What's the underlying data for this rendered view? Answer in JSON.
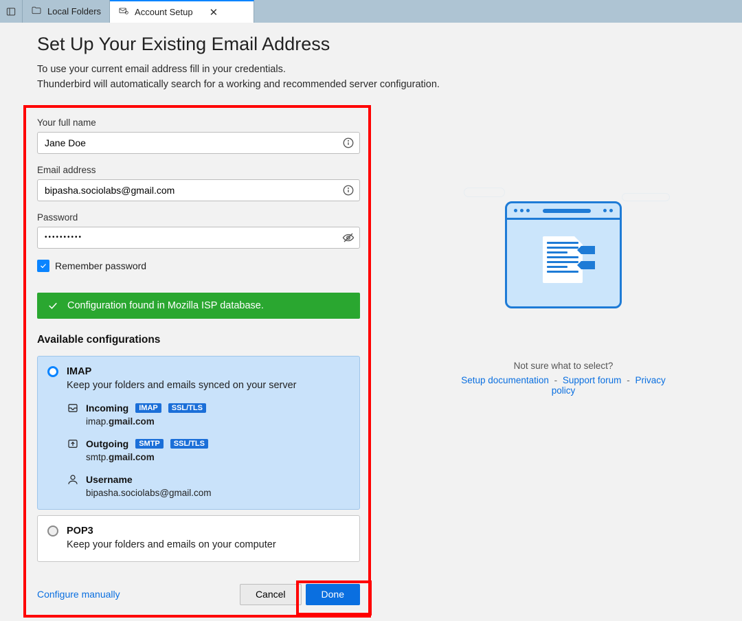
{
  "tabs": {
    "first": "Local Folders",
    "second": "Account Setup"
  },
  "heading": "Set Up Your Existing Email Address",
  "subtitle_l1": "To use your current email address fill in your credentials.",
  "subtitle_l2": "Thunderbird will automatically search for a working and recommended server configuration.",
  "fields": {
    "fullname_label": "Your full name",
    "fullname_value": "Jane Doe",
    "email_label": "Email address",
    "email_value": "bipasha.sociolabs@gmail.com",
    "password_label": "Password",
    "password_value": "••••••••••",
    "remember_label": "Remember password"
  },
  "alert_text": "Configuration found in Mozilla ISP database.",
  "available_title": "Available configurations",
  "imap": {
    "title": "IMAP",
    "desc": "Keep your folders and emails synced on your server",
    "incoming_label": "Incoming",
    "incoming_badge1": "IMAP",
    "incoming_badge2": "SSL/TLS",
    "incoming_host_pre": "imap.",
    "incoming_host_bold": "gmail.com",
    "outgoing_label": "Outgoing",
    "outgoing_badge1": "SMTP",
    "outgoing_badge2": "SSL/TLS",
    "outgoing_host_pre": "smtp.",
    "outgoing_host_bold": "gmail.com",
    "username_label": "Username",
    "username_value": "bipasha.sociolabs@gmail.com"
  },
  "pop3": {
    "title": "POP3",
    "desc": "Keep your folders and emails on your computer"
  },
  "actions": {
    "manual": "Configure manually",
    "cancel": "Cancel",
    "done": "Done"
  },
  "help": {
    "prompt": "Not sure what to select?",
    "doc": "Setup documentation",
    "forum": "Support forum",
    "privacy": "Privacy policy"
  }
}
